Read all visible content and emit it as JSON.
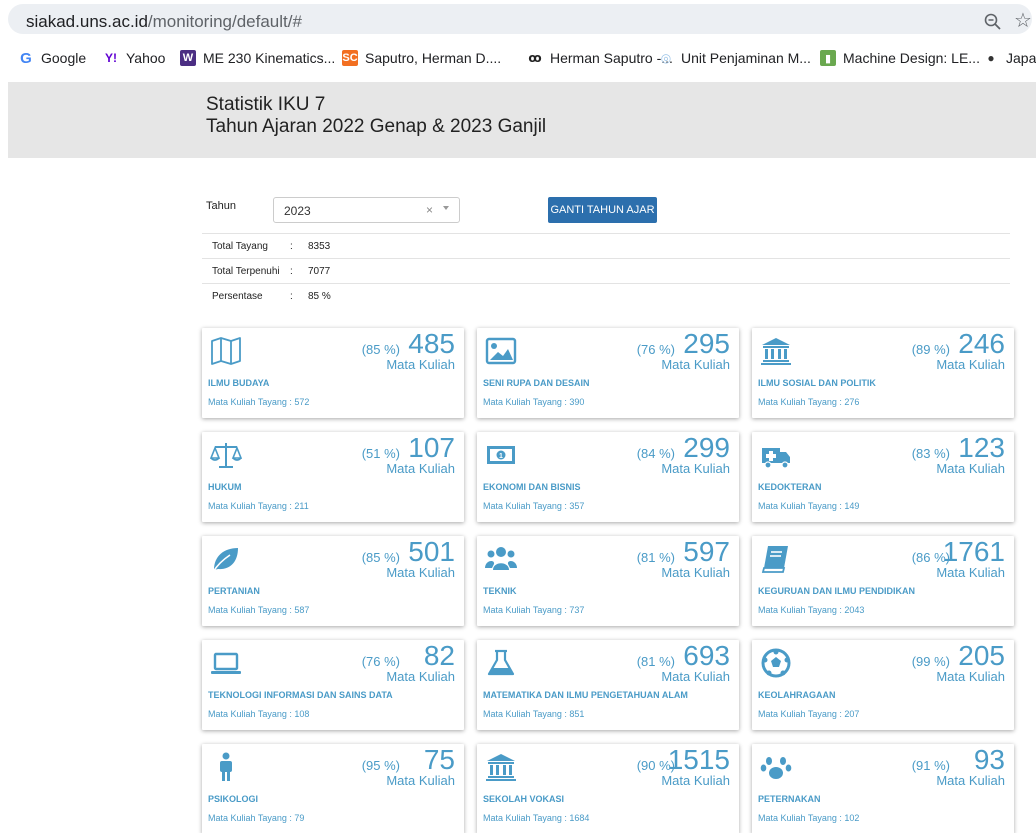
{
  "browser": {
    "url_host": "siakad.uns.ac.id",
    "url_path": "/monitoring/default/#",
    "bookmarks": [
      {
        "label": "Google",
        "icon": "google-icon",
        "color": "#4285f4",
        "glyph": "G"
      },
      {
        "label": "Yahoo",
        "icon": "yahoo-icon",
        "color": "#6001d2",
        "glyph": "Y!"
      },
      {
        "label": "ME 230 Kinematics...",
        "icon": "uw-icon",
        "color": "#4b2e83",
        "glyph": "W"
      },
      {
        "label": "Saputro, Herman D....",
        "icon": "sc-icon",
        "color": "#f26f21",
        "glyph": "SC"
      },
      {
        "label": "Herman Saputro -...",
        "icon": "researchgate-icon",
        "color": "#222222",
        "glyph": "ꝏ"
      },
      {
        "label": "Unit Penjaminan M...",
        "icon": "upm-icon",
        "color": "#9ec5e8",
        "glyph": "◎"
      },
      {
        "label": "Machine Design: LE...",
        "icon": "book-icon",
        "color": "#6aa84f",
        "glyph": "▮"
      },
      {
        "label": "Japan",
        "icon": "globe-icon",
        "color": "#333333",
        "glyph": "●"
      }
    ]
  },
  "header": {
    "title": "Statistik IKU 7",
    "subtitle": "Tahun Ajaran 2022 Genap & 2023 Ganjil"
  },
  "filter": {
    "label": "Tahun",
    "selected": "2023",
    "clear": "×",
    "button": "GANTI TAHUN AJAR"
  },
  "stats": [
    {
      "key": "Total Tayang",
      "sep": ":",
      "value": "8353"
    },
    {
      "key": "Total Terpenuhi",
      "sep": ":",
      "value": "7077"
    },
    {
      "key": "Persentase",
      "sep": ":",
      "value": "85 %"
    }
  ],
  "unit_label": "Mata Kuliah",
  "cards": [
    {
      "icon": "map-icon",
      "pct": "(85 %)",
      "num": "485",
      "name": "ILMU BUDAYA",
      "tayang": "Mata Kuliah Tayang : 572"
    },
    {
      "icon": "image-icon",
      "pct": "(76 %)",
      "num": "295",
      "name": "SENI RUPA DAN DESAIN",
      "tayang": "Mata Kuliah Tayang : 390"
    },
    {
      "icon": "institution-icon",
      "pct": "(89 %)",
      "num": "246",
      "name": "ILMU SOSIAL DAN POLITIK",
      "tayang": "Mata Kuliah Tayang : 276"
    },
    {
      "icon": "balance-scale-icon",
      "pct": "(51 %)",
      "num": "107",
      "name": "HUKUM",
      "tayang": "Mata Kuliah Tayang : 211"
    },
    {
      "icon": "money-bill-icon",
      "pct": "(84 %)",
      "num": "299",
      "name": "EKONOMI DAN BISNIS",
      "tayang": "Mata Kuliah Tayang : 357"
    },
    {
      "icon": "ambulance-icon",
      "pct": "(83 %)",
      "num": "123",
      "name": "KEDOKTERAN",
      "tayang": "Mata Kuliah Tayang : 149"
    },
    {
      "icon": "leaf-icon",
      "pct": "(85 %)",
      "num": "501",
      "name": "PERTANIAN",
      "tayang": "Mata Kuliah Tayang : 587"
    },
    {
      "icon": "users-icon",
      "pct": "(81 %)",
      "num": "597",
      "name": "TEKNIK",
      "tayang": "Mata Kuliah Tayang : 737"
    },
    {
      "icon": "book-icon",
      "pct": "(86 %)",
      "num": "1761",
      "name": "KEGURUAN DAN ILMU PENDIDIKAN",
      "tayang": "Mata Kuliah Tayang : 2043"
    },
    {
      "icon": "laptop-icon",
      "pct": "(76 %)",
      "num": "82",
      "name": "TEKNOLOGI INFORMASI DAN SAINS DATA",
      "tayang": "Mata Kuliah Tayang : 108"
    },
    {
      "icon": "flask-icon",
      "pct": "(81 %)",
      "num": "693",
      "name": "MATEMATIKA DAN ILMU PENGETAHUAN ALAM",
      "tayang": "Mata Kuliah Tayang : 851"
    },
    {
      "icon": "soccer-ball-icon",
      "pct": "(99 %)",
      "num": "205",
      "name": "KEOLAHRAGAAN",
      "tayang": "Mata Kuliah Tayang : 207"
    },
    {
      "icon": "male-icon",
      "pct": "(95 %)",
      "num": "75",
      "name": "PSIKOLOGI",
      "tayang": "Mata Kuliah Tayang : 79"
    },
    {
      "icon": "institution-icon",
      "pct": "(90 %)",
      "num": "1515",
      "name": "SEKOLAH VOKASI",
      "tayang": "Mata Kuliah Tayang : 1684"
    },
    {
      "icon": "paw-icon",
      "pct": "(91 %)",
      "num": "93",
      "name": "PETERNAKAN",
      "tayang": "Mata Kuliah Tayang : 102"
    }
  ],
  "colors": {
    "accent": "#4a9bc7",
    "button": "#2c6fad",
    "header_bg": "#e6e6e6"
  }
}
